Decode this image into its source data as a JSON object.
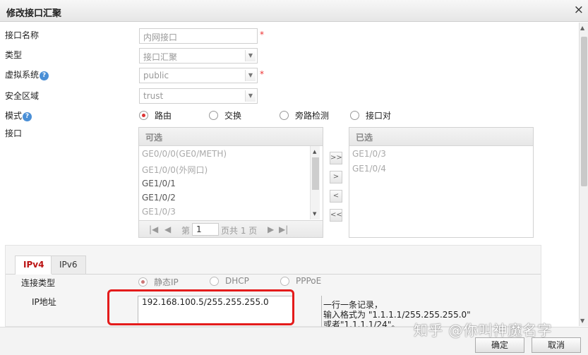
{
  "dialog": {
    "title": "修改接口汇聚",
    "close_icon": "×"
  },
  "form": {
    "name": {
      "label": "接口名称",
      "value": "内网接口",
      "required": "*"
    },
    "type": {
      "label": "类型",
      "value": "接口汇聚"
    },
    "vsys": {
      "label": "虚拟系统",
      "help": "?",
      "value": "public",
      "required": "*"
    },
    "zone": {
      "label": "安全区域",
      "value": "trust"
    },
    "mode": {
      "label": "模式",
      "help": "?",
      "options": [
        "路由",
        "交换",
        "旁路检测",
        "接口对"
      ],
      "selected": "路由"
    },
    "interface": {
      "label": "接口"
    }
  },
  "available": {
    "header": "可选",
    "items": [
      "GE0/0/0(GE0/METH)",
      "GE1/0/0(外网口)",
      "GE1/0/1",
      "GE1/0/2",
      "GE1/0/3"
    ],
    "pager": {
      "first": "|◀",
      "prev": "◀",
      "page_prefix": "第",
      "page": "1",
      "page_suffix": "页共 1 页",
      "next": "▶",
      "last": "▶|"
    }
  },
  "selected_list": {
    "header": "已选",
    "items": [
      "GE1/0/3",
      "GE1/0/4"
    ]
  },
  "move_buttons": {
    "add_all": ">>",
    "add": ">",
    "remove": "<",
    "remove_all": "<<"
  },
  "ip_section": {
    "tabs": [
      "IPv4",
      "IPv6"
    ],
    "active_tab": "IPv4",
    "conn_type": {
      "label": "连接类型",
      "options": [
        "静态IP",
        "DHCP",
        "PPPoE"
      ],
      "selected": "静态IP"
    },
    "ip": {
      "label": "IP地址",
      "value": "192.168.100.5/255.255.255.0"
    },
    "hint": [
      "一行一条记录，",
      "输入格式为 \"1.1.1.1/255.255.255.0\"",
      "或者\"1.1.1.1/24\"。"
    ]
  },
  "footer": {
    "ok": "确定",
    "cancel": "取消"
  },
  "watermark": "知乎 @你叫神魔名字",
  "colors": {
    "accent": "#b11111",
    "highlight": "#e41b1b",
    "help": "#4a8fd6"
  }
}
